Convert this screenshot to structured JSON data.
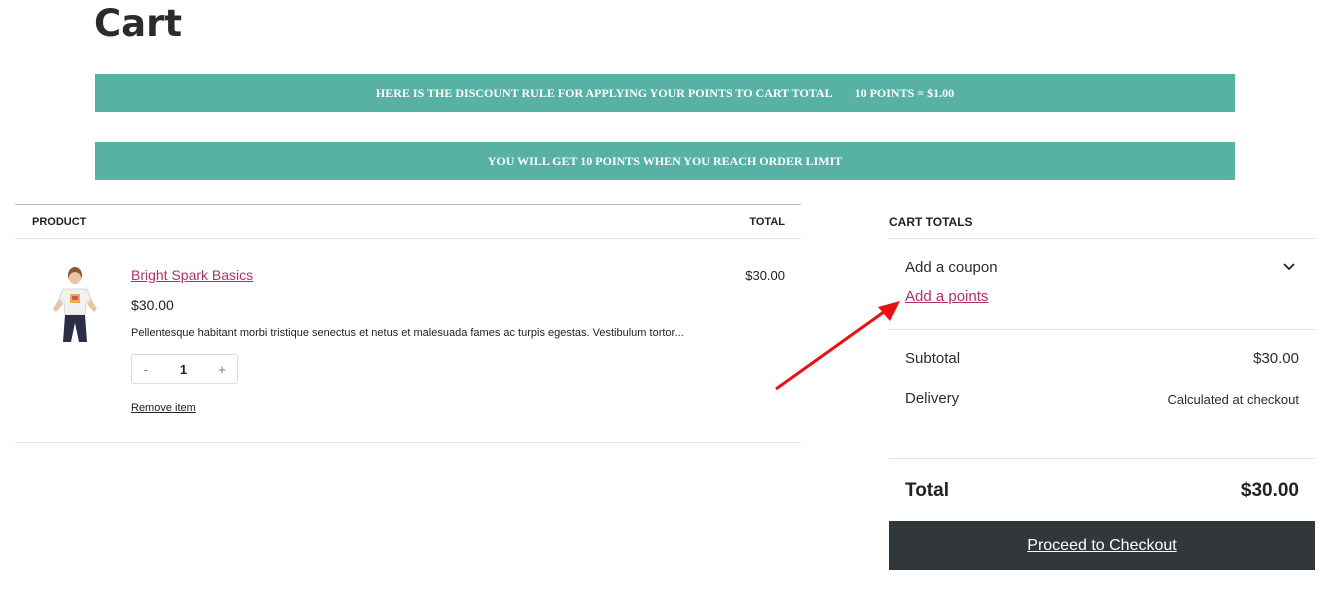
{
  "page": {
    "title": "Cart"
  },
  "banners": {
    "discount_rule": "HERE IS THE DISCOUNT RULE FOR APPLYING YOUR POINTS TO CART TOTAL",
    "discount_value": "10 POINTS = $1.00",
    "order_limit": "YOU WILL GET 10 POINTS WHEN YOU REACH ORDER LIMIT",
    "color": "#57b2a4"
  },
  "cart_table": {
    "headers": {
      "product": "PRODUCT",
      "total": "TOTAL"
    },
    "items": [
      {
        "name": "Bright Spark Basics",
        "price": "$30.00",
        "description": "Pellentesque habitant morbi tristique senectus et netus et malesuada fames ac turpis egestas. Vestibulum tortor...",
        "quantity": "1",
        "qty_minus": "-",
        "qty_plus": "+",
        "remove_label": "Remove item",
        "line_total": "$30.00"
      }
    ]
  },
  "totals": {
    "heading": "CART TOTALS",
    "coupon_label": "Add a coupon",
    "points_link": "Add a points",
    "subtotal_label": "Subtotal",
    "subtotal_value": "$30.00",
    "delivery_label": "Delivery",
    "delivery_value": "Calculated at checkout",
    "total_label": "Total",
    "total_value": "$30.00",
    "checkout_label": "Proceed to Checkout"
  },
  "colors": {
    "link": "#b0306a",
    "button": "#32373c",
    "arrow": "#e81010"
  }
}
